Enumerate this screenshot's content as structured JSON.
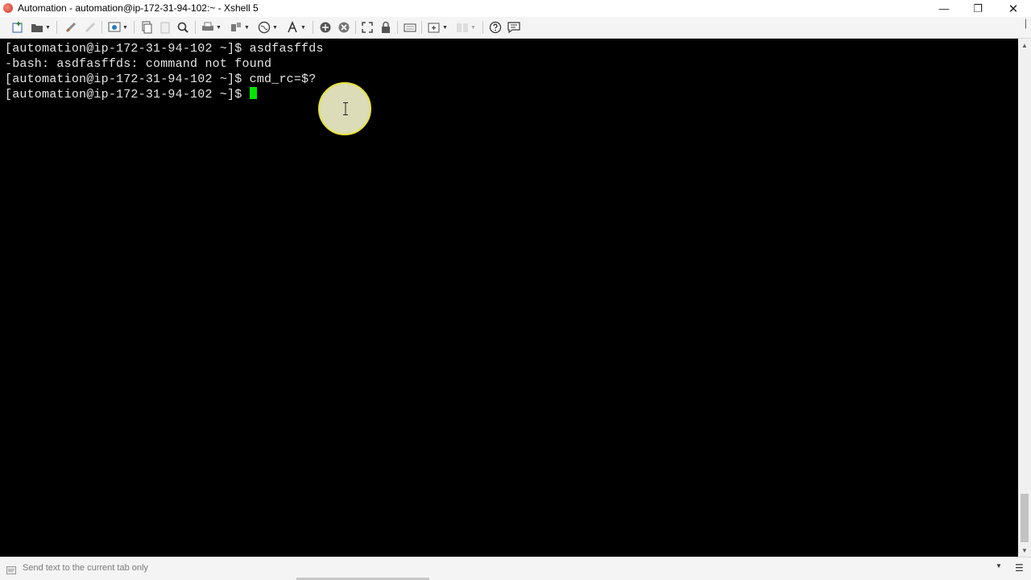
{
  "window": {
    "title": "Automation - automation@ip-172-31-94-102:~ - Xshell 5",
    "minimize_glyph": "—",
    "maximize_glyph": "❐",
    "close_glyph": "✕"
  },
  "toolbar": {
    "icons": [
      "new-session-icon",
      "open-folder-icon",
      "reconnect-icon",
      "disconnect-icon",
      "properties-icon",
      "copy-icon",
      "paste-icon",
      "find-icon",
      "print-icon",
      "transfer-icon",
      "globe-icon",
      "font-icon",
      "xftp-icon",
      "xmanager-icon",
      "fullscreen-icon",
      "lock-icon",
      "keyboard-icon",
      "new-tab-icon",
      "layout-icon",
      "help-icon",
      "chat-icon"
    ]
  },
  "terminal": {
    "lines": [
      "[automation@ip-172-31-94-102 ~]$ asdfasffds",
      "-bash: asdfasffds: command not found",
      "[automation@ip-172-31-94-102 ~]$ cmd_rc=$?",
      "[automation@ip-172-31-94-102 ~]$ "
    ],
    "cursor_color": "#00e600",
    "text_color": "#e6e6e6",
    "background": "#000000"
  },
  "statusbar": {
    "send_placeholder": "Send text to the current tab only"
  }
}
